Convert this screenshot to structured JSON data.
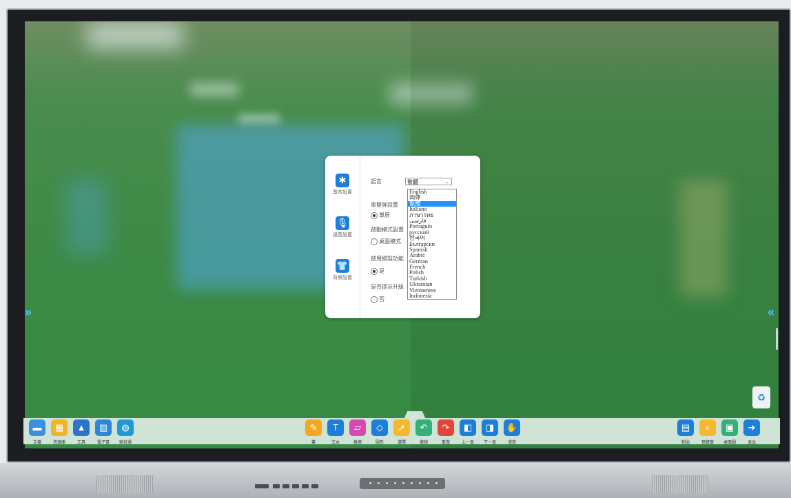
{
  "colors": {
    "accent": "#1e90ff",
    "screen_green": "#3d8a45",
    "taskbar": "#cfe3d7"
  },
  "dialog": {
    "nav": [
      {
        "label": "基本設置",
        "icon": "gear-icon"
      },
      {
        "label": "語音設置",
        "icon": "microphone-icon"
      },
      {
        "label": "背景設置",
        "icon": "shirt-icon"
      }
    ],
    "language_label": "語言",
    "language_value": "繁體",
    "screen_label": "單雙屏設置",
    "screen_option": "單屏",
    "startup_label": "啟動模式設置",
    "startup_option": "桌面模式",
    "draw_label": "啟用繪製功能",
    "draw_option": "是",
    "upgrade_label": "是否提示升級",
    "upgrade_option": "否",
    "languages": [
      "English",
      "简体",
      "繁體",
      "Italiano",
      "ภาษาไทย",
      "فارسی",
      "Portugués",
      "русский",
      "한국어",
      "Български",
      "Spanish",
      "Arabic",
      "German",
      "French",
      "Polish",
      "Turkish",
      "Ukrainian",
      "Vietnamese",
      "Indonesia"
    ],
    "selected_index": 2
  },
  "taskbar": {
    "left": [
      {
        "label": "文檔",
        "icon": "folder-icon",
        "color": "#3a8fe0"
      },
      {
        "label": "資源庫",
        "icon": "resources-icon",
        "color": "#f0b429"
      },
      {
        "label": "工具",
        "icon": "tools-icon",
        "color": "#2b74c8"
      },
      {
        "label": "電子書",
        "icon": "book-icon",
        "color": "#2d86d8"
      },
      {
        "label": "家校通",
        "icon": "chat-icon",
        "color": "#1f9ad6"
      }
    ],
    "center": [
      {
        "label": "筆",
        "icon": "pen-icon",
        "color": "#f5a623"
      },
      {
        "label": "文本",
        "icon": "text-icon",
        "color": "#1e7fd8"
      },
      {
        "label": "橡擦",
        "icon": "eraser-icon",
        "color": "#d94ab0"
      },
      {
        "label": "圖形",
        "icon": "shapes-icon",
        "color": "#1e7fd8"
      },
      {
        "label": "選擇",
        "icon": "cursor-icon",
        "color": "#f5b82e"
      },
      {
        "label": "撤銷",
        "icon": "undo-icon",
        "color": "#35b07a"
      },
      {
        "label": "重做",
        "icon": "redo-icon",
        "color": "#e0463a"
      },
      {
        "label": "上一頁",
        "icon": "prev-page-icon",
        "color": "#1e7fd8"
      },
      {
        "label": "下一頁",
        "icon": "next-page-icon",
        "color": "#1e7fd8"
      },
      {
        "label": "漫遊",
        "icon": "hand-icon",
        "color": "#1e7fd8"
      }
    ],
    "right": [
      {
        "label": "粘貼",
        "icon": "clipboard-icon",
        "color": "#1e7fd8"
      },
      {
        "label": "預覽窗",
        "icon": "preview-icon",
        "color": "#f5b82e"
      },
      {
        "label": "桌面圖",
        "icon": "desktop-icon",
        "color": "#35b07a"
      },
      {
        "label": "退出",
        "icon": "exit-icon",
        "color": "#1e7fd8"
      }
    ]
  }
}
